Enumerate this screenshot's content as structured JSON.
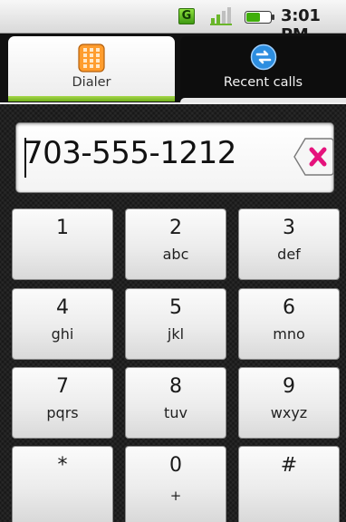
{
  "status_bar": {
    "network_badge": "G",
    "time": "3:01 PM"
  },
  "tabs": [
    {
      "label": "Dialer",
      "icon": "keypad-icon",
      "selected": true
    },
    {
      "label": "Recent calls",
      "icon": "recent-calls-icon",
      "selected": false
    }
  ],
  "dialer": {
    "number": "703-555-1212",
    "delete_icon": "delete-backspace-icon",
    "delete_color": "#e5137c"
  },
  "keypad": [
    {
      "digit": "1",
      "letters": ""
    },
    {
      "digit": "2",
      "letters": "abc"
    },
    {
      "digit": "3",
      "letters": "def"
    },
    {
      "digit": "4",
      "letters": "ghi"
    },
    {
      "digit": "5",
      "letters": "jkl"
    },
    {
      "digit": "6",
      "letters": "mno"
    },
    {
      "digit": "7",
      "letters": "pqrs"
    },
    {
      "digit": "8",
      "letters": "tuv"
    },
    {
      "digit": "9",
      "letters": "wxyz"
    },
    {
      "digit": "*",
      "letters": ""
    },
    {
      "digit": "0",
      "letters": "+"
    },
    {
      "digit": "#",
      "letters": ""
    }
  ],
  "colors": {
    "tab_indicator": "#8cc63e",
    "accent_green": "#6fae1c",
    "recent_icon_blue": "#2d8ee0"
  }
}
